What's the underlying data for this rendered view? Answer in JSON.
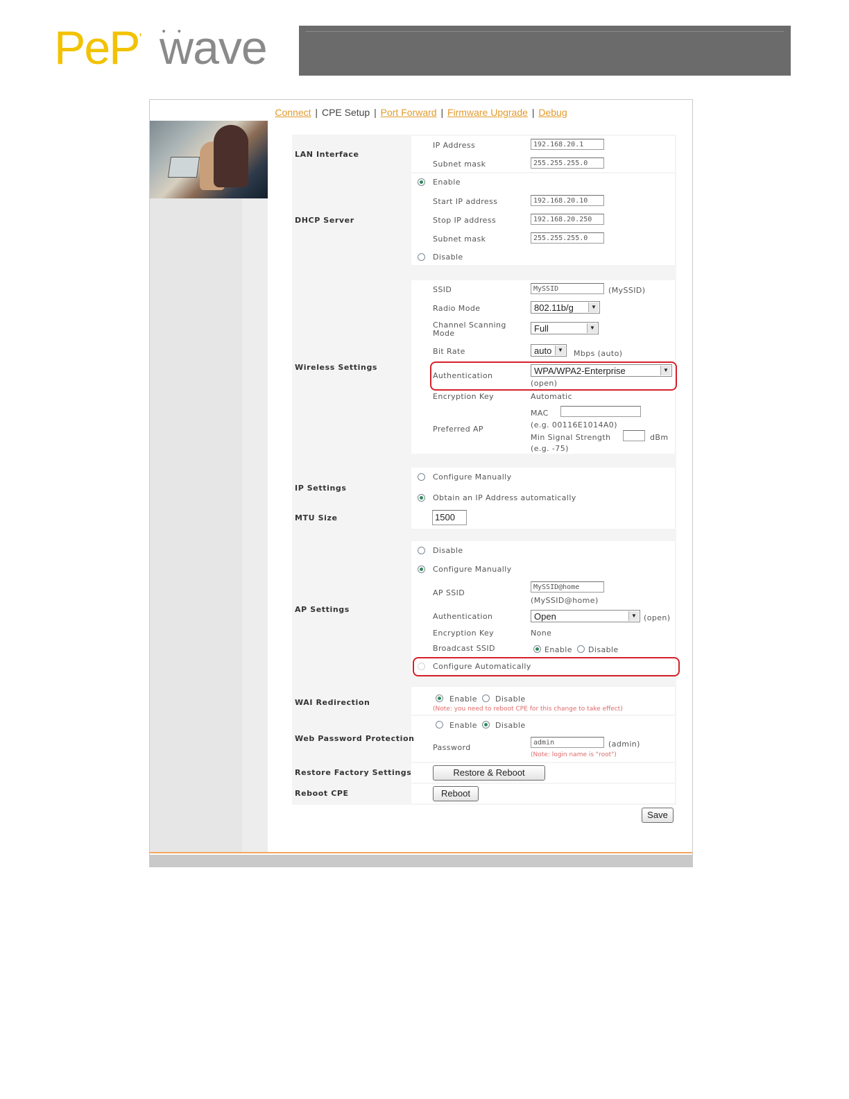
{
  "logo": {
    "pep": "PeP",
    "wave": "wave"
  },
  "nav": {
    "connect": "Connect",
    "cpe_setup": "CPE Setup",
    "port_forward": "Port Forward",
    "firmware_upgrade": "Firmware Upgrade",
    "debug": "Debug",
    "sep": "|"
  },
  "lan": {
    "label": "LAN Interface",
    "ip_label": "IP Address",
    "ip_value": "192.168.20.1",
    "mask_label": "Subnet mask",
    "mask_value": "255.255.255.0"
  },
  "dhcp": {
    "label": "DHCP Server",
    "enable": "Enable",
    "start_label": "Start IP address",
    "start_value": "192.168.20.10",
    "stop_label": "Stop IP address",
    "stop_value": "192.168.20.250",
    "mask_label": "Subnet mask",
    "mask_value": "255.255.255.0",
    "disable": "Disable"
  },
  "wireless": {
    "label": "Wireless Settings",
    "ssid_label": "SSID",
    "ssid_value": "MySSID",
    "ssid_default": "(MySSID)",
    "radio_label": "Radio Mode",
    "radio_value": "802.11b/g",
    "channel_label": "Channel Scanning Mode",
    "channel_value": "Full",
    "bitrate_label": "Bit Rate",
    "bitrate_value": "auto",
    "bitrate_unit": "Mbps (auto)",
    "auth_label": "Authentication",
    "auth_value": "WPA/WPA2-Enterprise",
    "auth_default": "(open)",
    "enc_label": "Encryption Key",
    "enc_value": "Automatic",
    "pref_label": "Preferred AP",
    "mac_label": "MAC",
    "mac_example": "(e.g. 00116E1014A0)",
    "signal_label": "Min Signal Strength",
    "signal_unit": "dBm",
    "signal_example": "(e.g. -75)"
  },
  "ip": {
    "label": "IP Settings",
    "manual": "Configure Manually",
    "auto": "Obtain an IP Address automatically"
  },
  "mtu": {
    "label": "MTU Size",
    "value": "1500"
  },
  "ap": {
    "label": "AP Settings",
    "disable": "Disable",
    "manual": "Configure Manually",
    "ssid_label": "AP SSID",
    "ssid_value": "MySSID@home",
    "ssid_default": "(MySSID@home)",
    "auth_label": "Authentication",
    "auth_value": "Open",
    "auth_default": "(open)",
    "enc_label": "Encryption Key",
    "enc_value": "None",
    "broadcast_label": "Broadcast SSID",
    "broadcast_enable": "Enable",
    "broadcast_disable": "Disable",
    "auto": "Configure Automatically"
  },
  "wai": {
    "label": "WAI Redirection",
    "enable": "Enable",
    "disable": "Disable",
    "note": "(Note: you need to reboot CPE for this change to take effect)"
  },
  "webpw": {
    "label": "Web Password Protection",
    "enable": "Enable",
    "disable": "Disable",
    "pw_label": "Password",
    "pw_value": "admin",
    "pw_default": "(admin)",
    "note": "(Note: login name is \"root\")"
  },
  "restore": {
    "label": "Restore Factory Settings",
    "button": "Restore & Reboot"
  },
  "reboot": {
    "label": "Reboot CPE",
    "button": "Reboot"
  },
  "save": {
    "button": "Save"
  },
  "colors": {
    "brand_yellow": "#f2c200",
    "link_orange": "#e29a2b",
    "highlight_red": "#d6202a",
    "header_gray": "#6b6b6b"
  }
}
